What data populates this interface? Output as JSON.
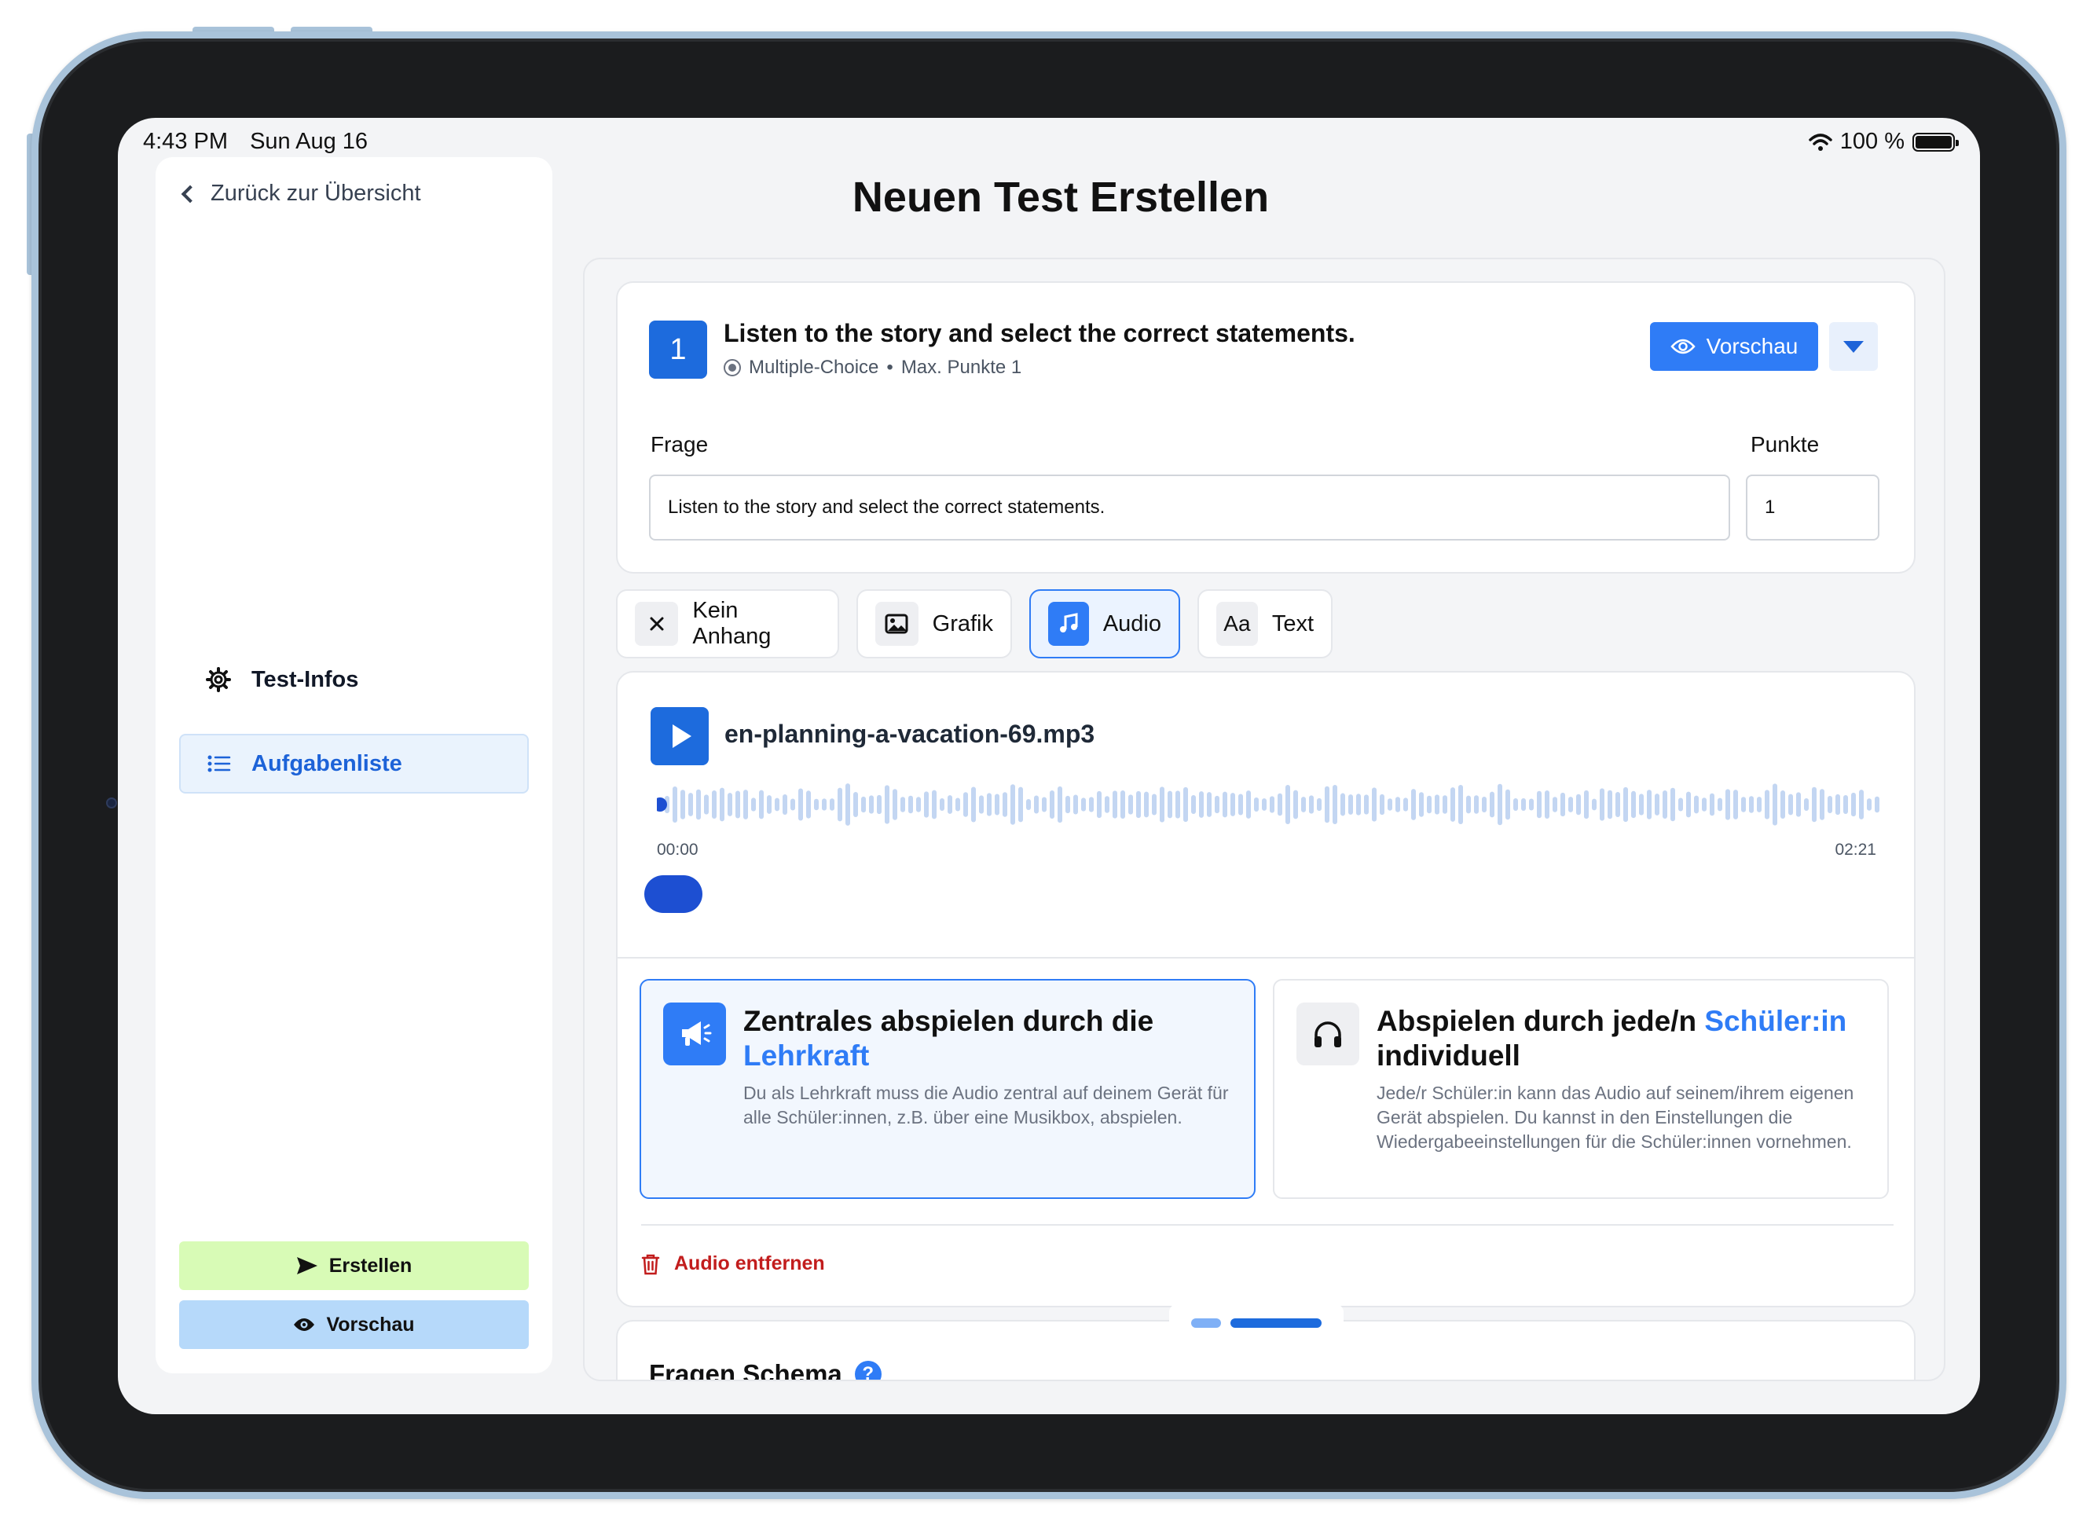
{
  "status_bar": {
    "time": "4:43 PM",
    "date": "Sun Aug 16",
    "battery": "100 %",
    "battery_level": 1.0
  },
  "sidebar": {
    "back_label": "Zurück zur Übersicht",
    "nav": [
      {
        "label": "Test-Infos",
        "icon": "gear-icon"
      },
      {
        "label": "Aufgabenliste",
        "icon": "list-icon",
        "active": true
      }
    ],
    "create_label": "Erstellen",
    "preview_label": "Vorschau"
  },
  "page": {
    "title": "Neuen Test Erstellen"
  },
  "question": {
    "number": "1",
    "title": "Listen to the story and select the correct statements.",
    "type": "Multiple-Choice",
    "separator": "•",
    "max_points": "Max. Punkte 1",
    "preview_label": "Vorschau",
    "question_label": "Frage",
    "question_value": "Listen to the story and select the correct statements.",
    "points_label": "Punkte",
    "points_value": "1"
  },
  "attachment_tabs": [
    {
      "label": "Kein Anhang",
      "icon": "close-icon"
    },
    {
      "label": "Grafik",
      "icon": "image-icon"
    },
    {
      "label": "Audio",
      "icon": "music-icon",
      "active": true
    },
    {
      "label": "Text",
      "icon": "text-icon",
      "glyph": "Aa"
    }
  ],
  "audio": {
    "file_name": "en-planning-a-vacation-69.mp3",
    "time_start": "00:00",
    "time_end": "02:21",
    "progress": 0.0,
    "options": [
      {
        "title": "Zentrales abspielen durch die",
        "title_highlight": "Lehrkraft",
        "description": "Du als Lehrkraft muss die Audio zentral auf deinem Gerät für alle Schüler:innen, z.B. über eine Musikbox, abspielen.",
        "icon": "megaphone-icon",
        "selected": true
      },
      {
        "title": "Abspielen durch jede/n",
        "title_highlight": "Schüler:in",
        "title_after": "individuell",
        "description": "Jede/r Schüler:in kann das Audio auf seinem/ihrem eigenen Gerät abspielen. Du kannst in den Einstellungen die Wiedergabeeinstellungen für die Schüler:innen vornehmen.",
        "icon": "headphones-icon",
        "selected": false
      }
    ],
    "remove_label": "Audio entfernen"
  },
  "schema": {
    "title": "Fragen Schema",
    "help_glyph": "?"
  },
  "colors": {
    "primary": "#2f7cf6",
    "primary_dark": "#1d6bdd",
    "danger": "#c21d1d",
    "create_bg": "#d8fbb6",
    "preview_bg": "#b6d9fa"
  }
}
